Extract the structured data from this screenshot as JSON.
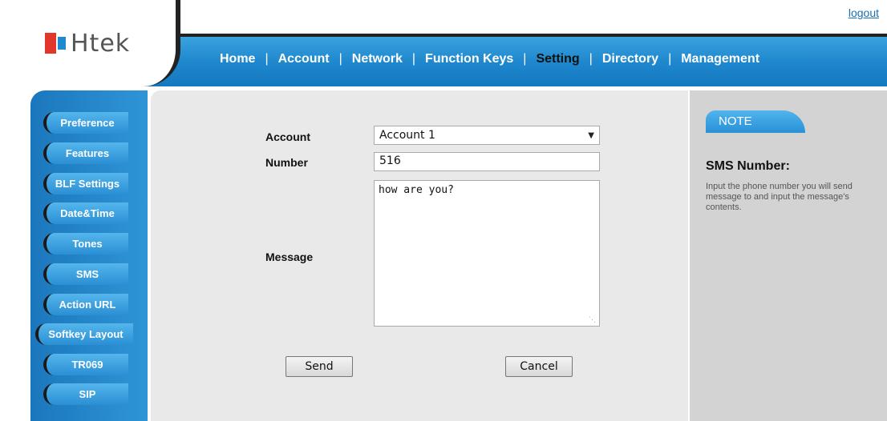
{
  "header": {
    "logo_text": "Htek",
    "logout_label": "logout",
    "nav": [
      {
        "label": "Home"
      },
      {
        "label": "Account"
      },
      {
        "label": "Network"
      },
      {
        "label": "Function Keys"
      },
      {
        "label": "Setting",
        "active": true
      },
      {
        "label": "Directory"
      },
      {
        "label": "Management"
      }
    ]
  },
  "sidebar": {
    "items": [
      {
        "label": "Preference"
      },
      {
        "label": "Features"
      },
      {
        "label": "BLF Settings"
      },
      {
        "label": "Date&Time"
      },
      {
        "label": "Tones"
      },
      {
        "label": "SMS",
        "active": true
      },
      {
        "label": "Action URL"
      },
      {
        "label": "Softkey Layout"
      },
      {
        "label": "TR069"
      },
      {
        "label": "SIP"
      }
    ]
  },
  "form": {
    "account_label": "Account",
    "account_value": "Account 1",
    "number_label": "Number",
    "number_value": "516",
    "message_label": "Message",
    "message_value": "how are you?",
    "send_label": "Send",
    "cancel_label": "Cancel"
  },
  "note": {
    "tab_label": "NOTE",
    "title": "SMS Number:",
    "text": "Input the phone number you will send message to and input the message's contents."
  },
  "colors": {
    "header_blue": "#1d86cc",
    "sidebar_blue": "#2f95d6",
    "logo_red": "#e2352b",
    "content_bg": "#e9e9e9",
    "note_bg": "#d3d3d3"
  }
}
